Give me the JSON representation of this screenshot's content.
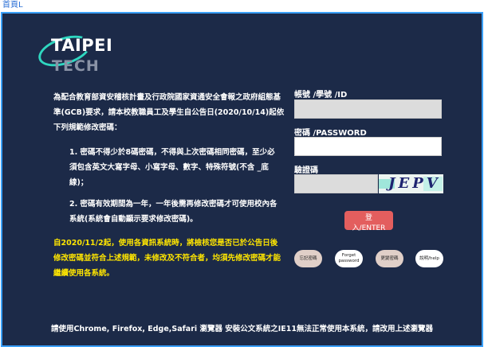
{
  "topbar": {
    "link": "首頁L"
  },
  "logo": {
    "line1": "TAIPEI",
    "line2": "TECH"
  },
  "intro": "為配合教育部資安稽核計畫及行政院國家資通安全會報之政府組態基準(GCB)要求，請本校教職員工及學生自公告日(2020/10/14)起依下列規範修改密碼：",
  "rules": [
    "1. 密碼不得少於8碼密碼，不得與上次密碼相同密碼，至少必須包含英文大寫字母、小寫字母、數字、特殊符號(不含 _底線)；",
    "2. 密碼有效期間為一年，一年後需再修改密碼才可使用校內各系統(系統會自動顯示要求修改密碼)。"
  ],
  "notice": "自2020/11/2起，使用各資訊系統時，將檢核您是否已於公告日後修改密碼並符合上述規範，未修改及不符合者，均須先修改密碼才能繼續使用各系統。",
  "footer": "請使用Chrome, Firefox, Edge,Safari 瀏覽器 安裝公文系統之IE11無法正常使用本系統，請改用上述瀏覽器",
  "form": {
    "id_label": "帳號 /學號 /ID",
    "id_value": "",
    "password_label": "密碼 /PASSWORD",
    "password_value": "",
    "captcha_label": "驗證碼",
    "captcha_value": "",
    "captcha_text": "JEPV"
  },
  "buttons": {
    "login": "登入/ENTER",
    "forgot_zh": "忘記密碼",
    "forgot_en": "Forget password",
    "change": "更變密碼",
    "help": "說明/help"
  },
  "colors": {
    "background": "#1c2a48",
    "notice": "#ffe600",
    "login": "#e35e5e",
    "logo_accent": "#2fd7c0"
  }
}
